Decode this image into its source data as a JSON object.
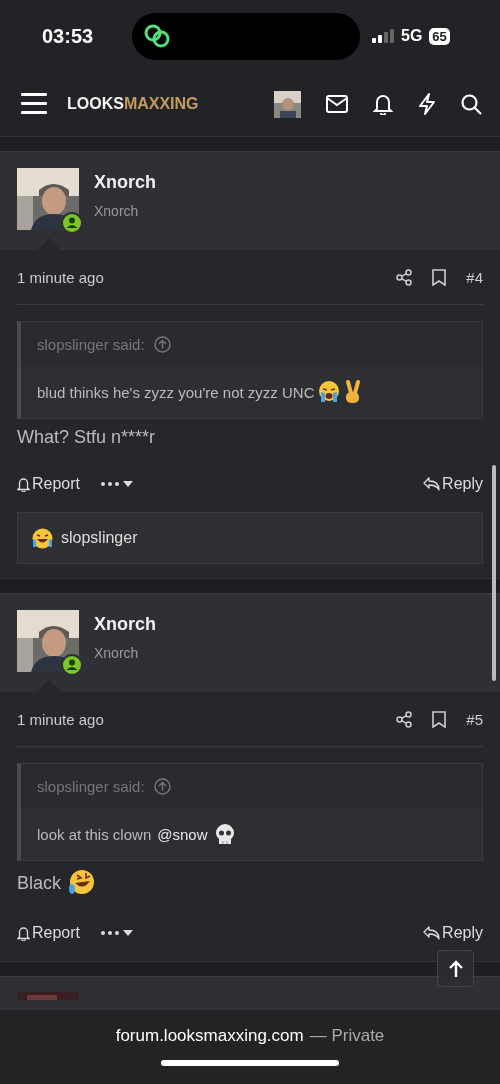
{
  "status_bar": {
    "time": "03:53",
    "network": "5G",
    "battery": "65"
  },
  "navbar": {
    "logo_first": "LOOKS",
    "logo_second": "MAXXING"
  },
  "posts": [
    {
      "author": "Xnorch",
      "user_title": "Xnorch",
      "online": true,
      "time": "1 minute ago",
      "number": "#4",
      "quote": {
        "attribution": "slopslinger said:",
        "text": "blud thinks he's zyzz you're not zyzz UNC",
        "emojis": [
          {
            "kind": "crying"
          },
          {
            "kind": "victory"
          }
        ]
      },
      "body": "What? Stfu n****r",
      "actions": {
        "report": "Report",
        "reply": "Reply"
      },
      "reactions": [
        {
          "kind": "laughing",
          "user": "slopslinger"
        }
      ]
    },
    {
      "author": "Xnorch",
      "user_title": "Xnorch",
      "online": true,
      "time": "1 minute ago",
      "number": "#5",
      "quote": {
        "attribution": "slopslinger said:",
        "text": "look at this clown",
        "mention": "@snow",
        "emojis": [
          {
            "kind": "skull"
          }
        ]
      },
      "body": "Black",
      "body_emojis": [
        {
          "kind": "rofl"
        }
      ],
      "actions": {
        "report": "Report",
        "reply": "Reply"
      }
    }
  ],
  "browser_bar": {
    "url": "forum.looksmaxxing.com",
    "mode": "— Private"
  }
}
